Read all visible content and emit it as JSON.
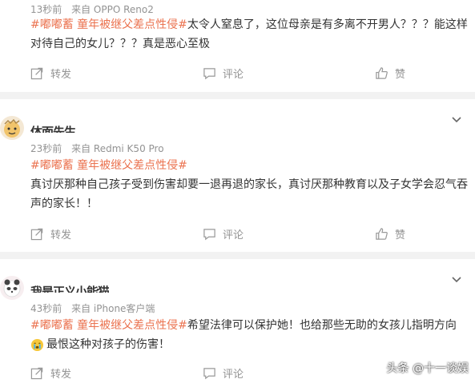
{
  "posts": [
    {
      "meta_time": "13秒前",
      "meta_source": "来自 OPPO Reno2",
      "tag": "#嘟嘟蓄 童年被继父差点性侵#",
      "text": "太令人窒息了，这位母亲是有多离不开男人？？？能这样对待自己的女儿？？？真是恶心至极",
      "actions": {
        "share": "转发",
        "comment": "评论",
        "like": "赞"
      }
    },
    {
      "username": "体面先生",
      "meta_time": "23秒前",
      "meta_source": "来自 Redmi K50 Pro",
      "tag": "#嘟嘟蓄 童年被继父差点性侵#",
      "text": "真讨厌那种自己孩子受到伤害却要一退再退的家长，真讨厌那种教育以及子女学会忍气吞声的家长！！",
      "actions": {
        "share": "转发",
        "comment": "评论",
        "like": "赞"
      }
    },
    {
      "username": "我是正义小能猫",
      "meta_time": "43秒前",
      "meta_source": "来自 iPhone客户端",
      "tag": "#嘟嘟蓄 童年被继父差点性侵#",
      "text": "希望法律可以保护她！也给那些无助的女孩儿指明方向",
      "text2": "最恨这种对孩子的伤害！",
      "actions": {
        "share": "转发",
        "comment": "评论",
        "like": "赞"
      }
    }
  ],
  "watermark": "头条 @十一谈娱",
  "colors": {
    "tag": "#eb7350",
    "meta": "#939393",
    "separator": "#f2f2f2"
  }
}
